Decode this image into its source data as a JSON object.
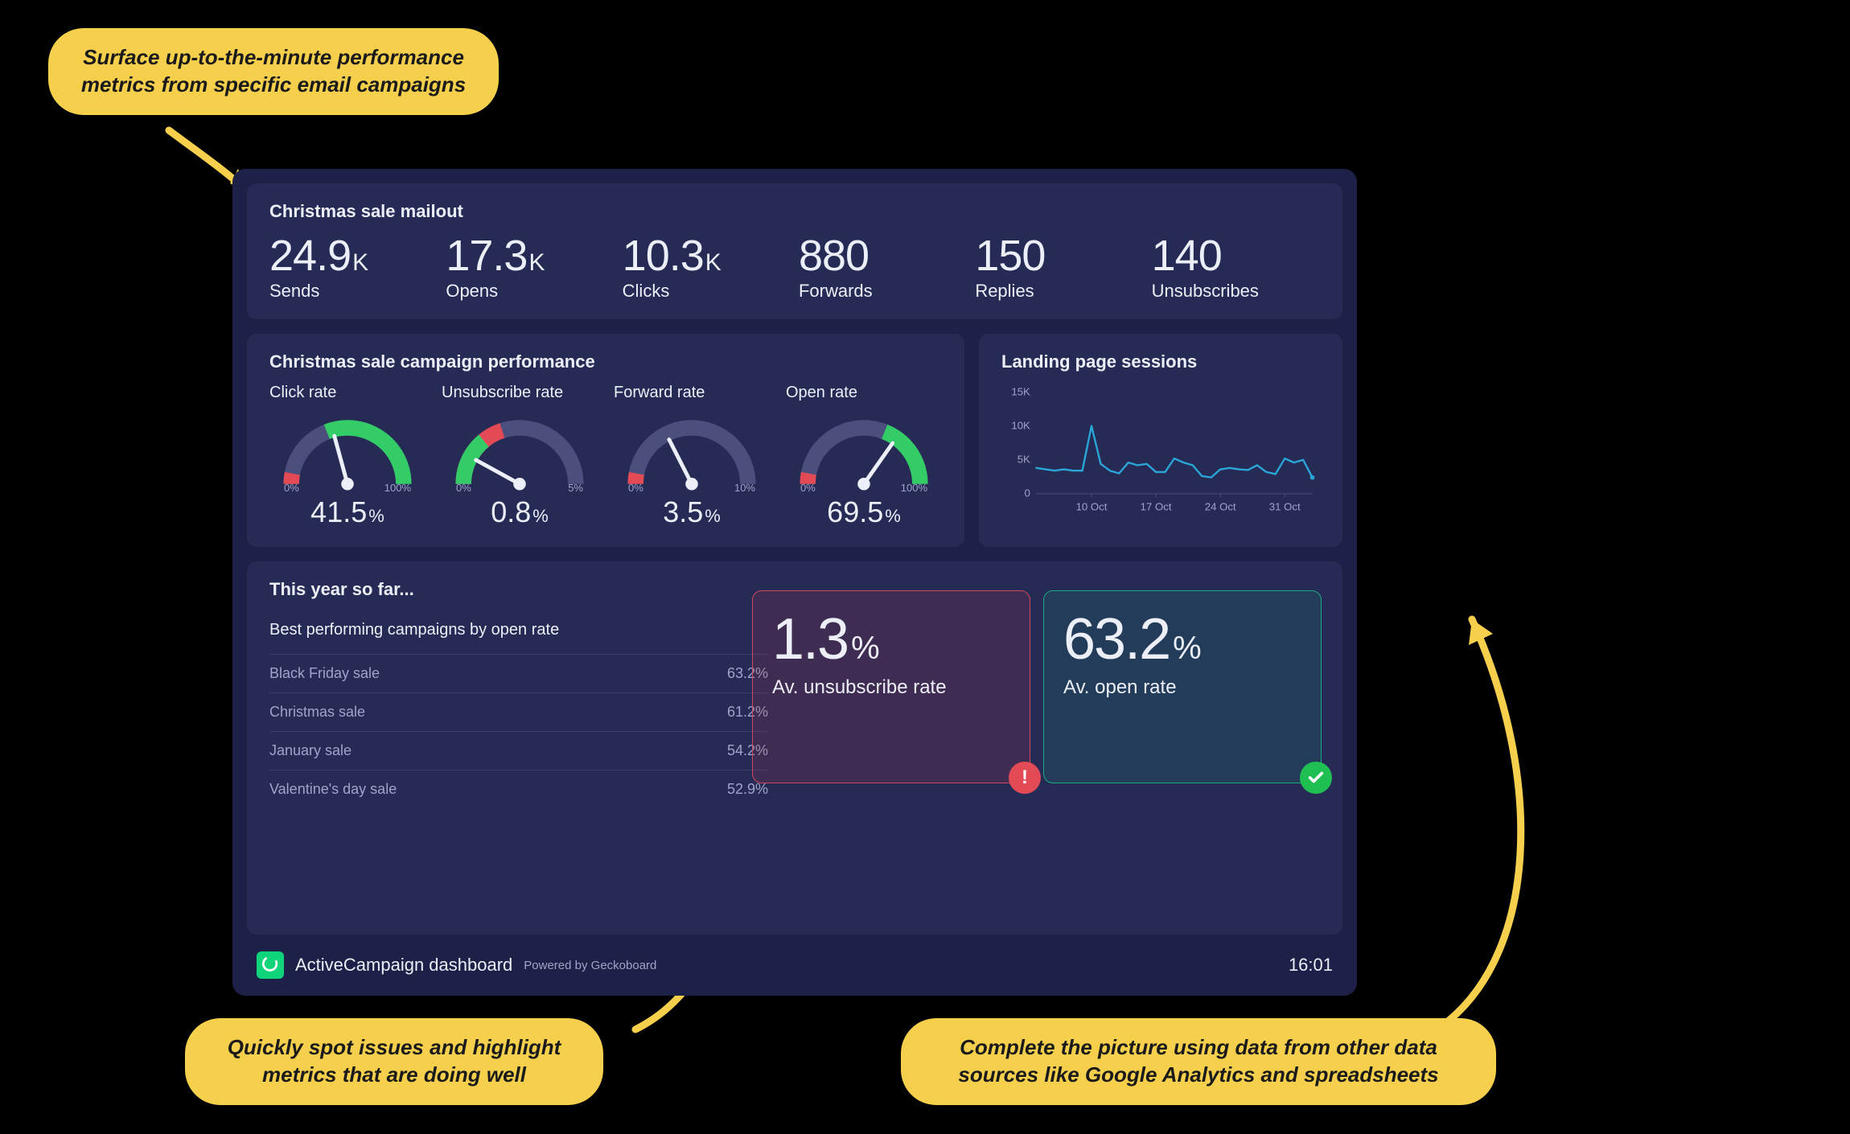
{
  "callouts": {
    "top": "Surface up-to-the-minute performance metrics from specific email campaigns",
    "left": "Quickly spot issues and highlight metrics that are doing well",
    "right": "Complete the picture using data from other data sources like Google Analytics and spreadsheets"
  },
  "mailout": {
    "title": "Christmas sale mailout",
    "stats": [
      {
        "value": "24.9",
        "unit": "K",
        "label": "Sends"
      },
      {
        "value": "17.3",
        "unit": "K",
        "label": "Opens"
      },
      {
        "value": "10.3",
        "unit": "K",
        "label": "Clicks"
      },
      {
        "value": "880",
        "unit": "",
        "label": "Forwards"
      },
      {
        "value": "150",
        "unit": "",
        "label": "Replies"
      },
      {
        "value": "140",
        "unit": "",
        "label": "Unsubscribes"
      }
    ]
  },
  "gauges": {
    "title": "Christmas sale campaign performance",
    "items": [
      {
        "label": "Click rate",
        "value": "41.5",
        "min": "0%",
        "max": "100%",
        "frac": 0.415,
        "good_from": 0.38,
        "bad_max": 0.06
      },
      {
        "label": "Unsubscribe rate",
        "value": "0.8",
        "min": "0%",
        "max": "5%",
        "frac": 0.16,
        "good_from": 0.0,
        "bad_max": 0.4,
        "good_to": 0.28
      },
      {
        "label": "Forward rate",
        "value": "3.5",
        "min": "0%",
        "max": "10%",
        "frac": 0.35,
        "good_from": 1.0,
        "bad_max": 0.06
      },
      {
        "label": "Open rate",
        "value": "69.5",
        "min": "0%",
        "max": "100%",
        "frac": 0.695,
        "good_from": 0.62,
        "bad_max": 0.06
      }
    ]
  },
  "sessions": {
    "title": "Landing page sessions",
    "y_ticks": [
      "15K",
      "10K",
      "5K",
      "0"
    ]
  },
  "year": {
    "title": "This year so far...",
    "subtitle": "Best performing campaigns by open rate",
    "rows": [
      {
        "name": "Black Friday sale",
        "value": "63.2%"
      },
      {
        "name": "Christmas sale",
        "value": "61.2%"
      },
      {
        "name": "January sale",
        "value": "54.2%"
      },
      {
        "name": "Valentine's day sale",
        "value": "52.9%"
      }
    ],
    "unsub": {
      "value": "1.3",
      "label": "Av. unsubscribe rate"
    },
    "open": {
      "value": "63.2",
      "label": "Av. open rate"
    }
  },
  "footer": {
    "title": "ActiveCampaign dashboard",
    "powered": "Powered by Geckoboard",
    "time": "16:01"
  },
  "chart_data": [
    {
      "type": "gauge",
      "title": "Christmas sale campaign performance",
      "series": [
        {
          "name": "Click rate",
          "value": 41.5,
          "min": 0,
          "max": 100
        },
        {
          "name": "Unsubscribe rate",
          "value": 0.8,
          "min": 0,
          "max": 5
        },
        {
          "name": "Forward rate",
          "value": 3.5,
          "min": 0,
          "max": 10
        },
        {
          "name": "Open rate",
          "value": 69.5,
          "min": 0,
          "max": 100
        }
      ]
    },
    {
      "type": "line",
      "title": "Landing page sessions",
      "xlabel": "",
      "ylabel": "",
      "ylim": [
        0,
        15000
      ],
      "y_ticks": [
        0,
        5000,
        10000,
        15000
      ],
      "x_tick_labels": [
        "10 Oct",
        "17 Oct",
        "24 Oct",
        "31 Oct"
      ],
      "x": [
        "04 Oct",
        "05 Oct",
        "06 Oct",
        "07 Oct",
        "08 Oct",
        "09 Oct",
        "10 Oct",
        "11 Oct",
        "12 Oct",
        "13 Oct",
        "14 Oct",
        "15 Oct",
        "16 Oct",
        "17 Oct",
        "18 Oct",
        "19 Oct",
        "20 Oct",
        "21 Oct",
        "22 Oct",
        "23 Oct",
        "24 Oct",
        "25 Oct",
        "26 Oct",
        "27 Oct",
        "28 Oct",
        "29 Oct",
        "30 Oct",
        "31 Oct",
        "01 Nov",
        "02 Nov",
        "03 Nov"
      ],
      "values": [
        3800,
        3600,
        3400,
        3600,
        3400,
        3400,
        10000,
        4400,
        3400,
        3000,
        4600,
        4200,
        4400,
        3200,
        3200,
        5200,
        4600,
        4200,
        2600,
        2400,
        3600,
        3800,
        3600,
        3500,
        4200,
        3200,
        2900,
        5200,
        4600,
        5000,
        2400
      ]
    },
    {
      "type": "table",
      "title": "Best performing campaigns by open rate",
      "categories": [
        "Black Friday sale",
        "Christmas sale",
        "January sale",
        "Valentine's day sale"
      ],
      "values": [
        63.2,
        61.2,
        54.2,
        52.9
      ]
    }
  ]
}
